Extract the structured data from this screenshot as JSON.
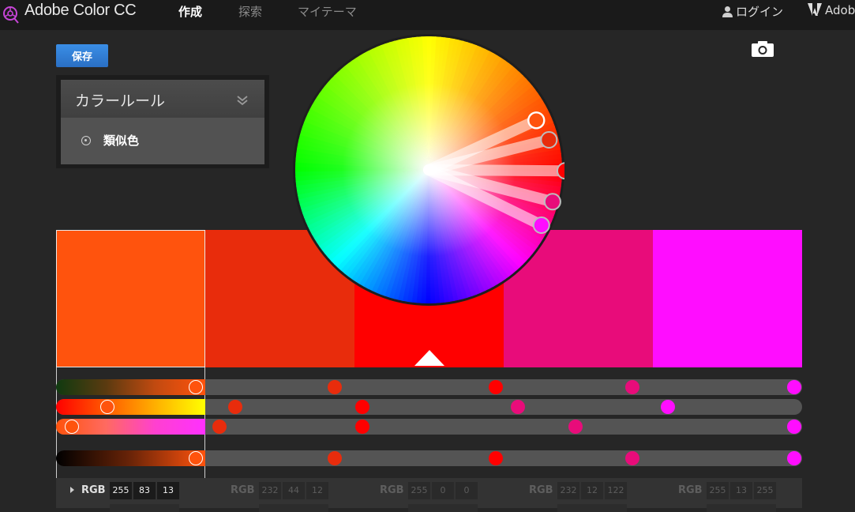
{
  "header": {
    "app_title": "Adobe Color CC",
    "nav": [
      "作成",
      "探索",
      "マイテーマ"
    ],
    "login": "ログイン",
    "adobe_link": "Adobe"
  },
  "toolbar": {
    "save_label": "保存"
  },
  "color_rule": {
    "title": "カラールール",
    "selected_option": "類似色"
  },
  "colors": {
    "accent": "#2f7fd6",
    "swatches": [
      "#FF530D",
      "#E82C0C",
      "#FF0000",
      "#E80C7A",
      "#FF0DFF"
    ],
    "selected_index": 0
  },
  "rgb": [
    {
      "label": "RGB",
      "values": [
        "255",
        "83",
        "13"
      ]
    },
    {
      "label": "RGB",
      "values": [
        "232",
        "44",
        "12"
      ]
    },
    {
      "label": "RGB",
      "values": [
        "255",
        "0",
        "0"
      ]
    },
    {
      "label": "RGB",
      "values": [
        "232",
        "12",
        "122"
      ]
    },
    {
      "label": "RGB",
      "values": [
        "255",
        "13",
        "255"
      ]
    }
  ],
  "icons": [
    "color-wheel-logo-icon",
    "user-icon",
    "adobe-logo-icon",
    "camera-icon",
    "chevron-down-icon",
    "radio-icon",
    "caret-right-icon"
  ]
}
